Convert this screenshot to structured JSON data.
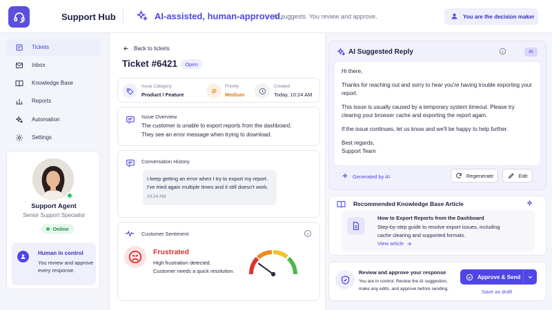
{
  "header": {
    "app_title": "Support Hub",
    "tagline": "AI-assisted, human-approved.",
    "subtagline": "AI suggests. You review and approve.",
    "decision_badge": "You are the decision maker"
  },
  "sidebar": {
    "items": [
      {
        "label": "Tickets",
        "icon": "ticket-icon",
        "active": true
      },
      {
        "label": "Inbox",
        "icon": "mail-icon",
        "active": false
      },
      {
        "label": "Knowledge Base",
        "icon": "book-icon",
        "active": false
      },
      {
        "label": "Reports",
        "icon": "bar-chart-icon",
        "active": false
      },
      {
        "label": "Automation",
        "icon": "sparkle-icon",
        "active": false
      },
      {
        "label": "Settings",
        "icon": "gear-icon",
        "active": false
      }
    ],
    "agent": {
      "name": "Support Agent",
      "role": "Senior Support Specialist",
      "status": "Online"
    },
    "human_in_control": {
      "title": "Human in control",
      "text": "You review and approve every response."
    }
  },
  "ticket": {
    "back_label": "Back to tickets",
    "title": "Ticket #6421",
    "status": "Open",
    "meta": {
      "category_label": "Issue Category",
      "category_value": "Product / Feature",
      "priority_label": "Priority",
      "priority_value": "Medium",
      "created_label": "Created",
      "created_value": "Today, 10:24 AM"
    },
    "overview": {
      "title": "Issue Overview",
      "text": "The customer is unable to export reports from the dashboard. They see an error message when trying to download."
    },
    "history": {
      "title": "Conversation History",
      "message": "I keep getting an error when I try to export my report. I've tried again multiple times and it still doesn't work.",
      "time": "10:24 AM"
    },
    "sentiment": {
      "title": "Customer Sentiment",
      "label": "Frustrated",
      "line1": "High frustration detected.",
      "line2": "Customer needs a quick resolution.",
      "gauge_level": 0.2
    }
  },
  "reply": {
    "title": "AI Suggested Reply",
    "badge": "AI",
    "greeting": "Hi there,",
    "p1": "Thanks for reaching out and sorry to hear you're having trouble exporting your report.",
    "p2": "This issue is usually caused by a temporary system timeout. Please try clearing your browser cache and exporting the report again.",
    "p3": "If the issue continues, let us know and we'll be happy to help further.",
    "signoff1": "Best regards,",
    "signoff2": "Support Team",
    "generated_by": "Generated by AI",
    "regenerate_label": "Regenerate",
    "edit_label": "Edit"
  },
  "kb": {
    "title": "Recommended Knowledge Base Article",
    "article_title": "How to Export Reports from the Dashboard",
    "article_text": "Step-by-step guide to resolve export issues, including cache clearing and supported formats.",
    "link_label": "View article"
  },
  "review": {
    "title": "Review and approve your response",
    "text": "You are in control. Review the AI suggestion, make any edits, and approve before sending.",
    "approve_label": "Approve & Send",
    "draft_label": "Save as draft"
  },
  "colors": {
    "accent": "#4f46e5",
    "frustrated": "#dc2f2f",
    "priority": "#e07a10",
    "online": "#22c55e"
  }
}
